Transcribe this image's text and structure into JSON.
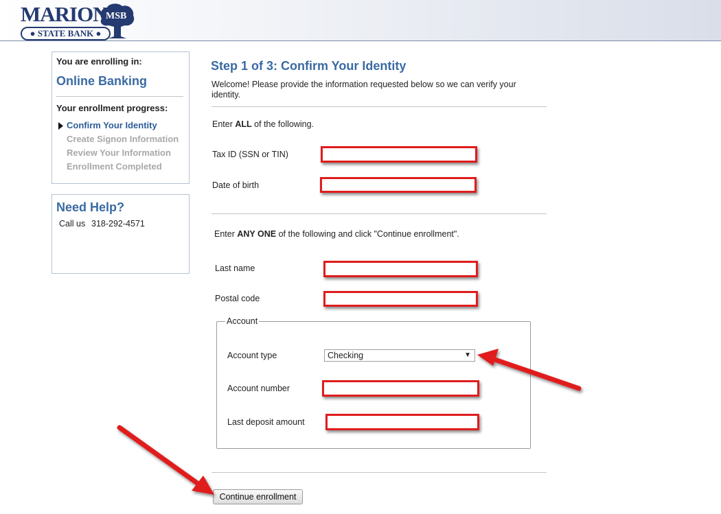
{
  "header": {
    "logo_name": "MARION",
    "logo_subtitle": "STATE BANK",
    "logo_monogram": "MSB"
  },
  "sidebar": {
    "enrolling_label": "You are enrolling in:",
    "product": "Online Banking",
    "progress_label": "Your enrollment progress:",
    "steps": [
      {
        "label": "Confirm Your Identity"
      },
      {
        "label": "Create Signon Information"
      },
      {
        "label": "Review Your Information"
      },
      {
        "label": "Enrollment Completed"
      }
    ],
    "help": {
      "title": "Need Help?",
      "call_label": "Call us",
      "phone": "318-292-4571"
    }
  },
  "main": {
    "title": "Step 1 of 3: Confirm Your Identity",
    "intro_line1": "Welcome! Please provide the information requested below so we can verify your",
    "intro_line2": "identity.",
    "all_prefix": "Enter",
    "all_bold": "ALL",
    "all_suffix": "of the following.",
    "tax_id_label": "Tax ID (SSN or TIN)",
    "tax_id_value": "",
    "dob_label": "Date of birth",
    "dob_value": "",
    "any_prefix": "Enter",
    "any_bold": "ANY ONE",
    "any_suffix": "of the following and click \"Continue enrollment\".",
    "last_name_label": "Last name",
    "last_name_value": "",
    "postal_label": "Postal code",
    "postal_value": "",
    "account": {
      "legend": "Account",
      "type_label": "Account type",
      "type_value": "Checking",
      "number_label": "Account number",
      "number_value": "",
      "deposit_label": "Last deposit amount",
      "deposit_value": ""
    },
    "continue_button": "Continue enrollment"
  },
  "colors": {
    "accent": "#3a6aa3",
    "highlight_border": "#e01c1c",
    "inactive_step": "#a8a8a8"
  },
  "icons": [
    "step-pointer-icon",
    "dropdown-caret-icon",
    "annotation-arrow"
  ]
}
